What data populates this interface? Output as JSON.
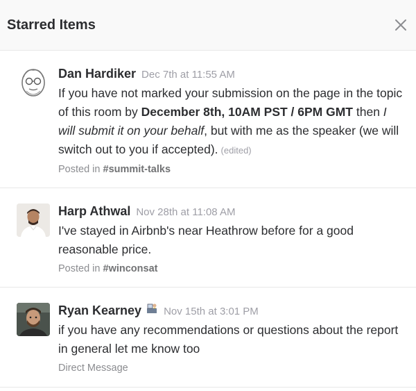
{
  "header": {
    "title": "Starred Items",
    "close_icon": "close-icon"
  },
  "items": [
    {
      "author": "Dan Hardiker",
      "timestamp": "Dec 7th at 11:55 AM",
      "message": {
        "part1": "If you have not marked your submission on the page in the topic of this room by ",
        "bold": "December 8th, 10AM PST / 6PM GMT",
        "part2": " then ",
        "italic": "I will submit it on your behalf",
        "part3": ", but with me as the speaker (we will switch out to you if accepted)."
      },
      "edited": "(edited)",
      "posted_prefix": "Posted in",
      "channel": "#summit-talks",
      "avatar_icon": "cartoon-face-avatar"
    },
    {
      "author": "Harp Athwal",
      "timestamp": "Nov 28th at 11:08 AM",
      "message": "I've stayed in Airbnb's near Heathrow before for a good reasonable price.",
      "posted_prefix": "Posted in",
      "channel": "#winconsat",
      "avatar_icon": "person-photo-avatar"
    },
    {
      "author": "Ryan Kearney",
      "status_icon": "desk-worker-emoji",
      "timestamp": "Nov 15th at 3:01 PM",
      "message": "if you have any recommendations or questions about the report in general let me know too",
      "context": "Direct Message",
      "avatar_icon": "person-photo-avatar"
    }
  ],
  "colors": {
    "header_bg": "#f9f9f9",
    "meta_gray": "#9e9ea6",
    "text": "#2c2d30",
    "divider": "#e8e8e8"
  }
}
